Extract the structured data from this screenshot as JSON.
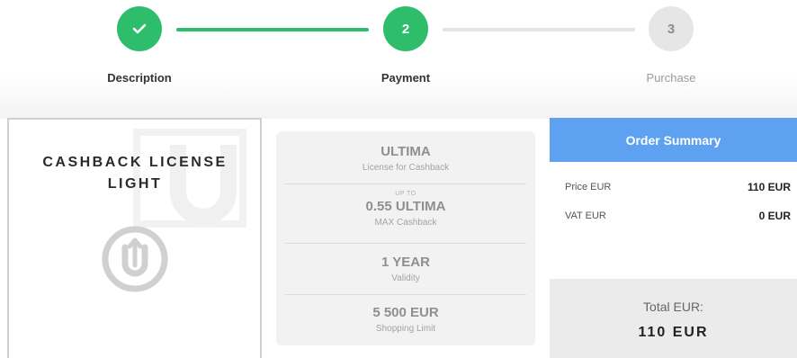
{
  "stepper": {
    "steps": [
      {
        "number": "",
        "label": "Description",
        "state": "done"
      },
      {
        "number": "2",
        "label": "Payment",
        "state": "active"
      },
      {
        "number": "3",
        "label": "Purchase",
        "state": "todo"
      }
    ]
  },
  "product": {
    "title": "CASHBACK LICENSE LIGHT"
  },
  "features": {
    "plan": {
      "value": "ULTIMA",
      "caption": "License for Cashback"
    },
    "cashback": {
      "prefix": "UP TO",
      "value": "0.55 ULTIMA",
      "caption": "MAX Cashback"
    },
    "validity": {
      "value": "1 YEAR",
      "caption": "Validity"
    },
    "limit": {
      "value": "5 500 EUR",
      "caption": "Shopping Limit"
    }
  },
  "order_summary": {
    "title": "Order Summary",
    "rows": [
      {
        "label": "Price EUR",
        "value": "110 EUR"
      },
      {
        "label": "VAT EUR",
        "value": "0 EUR"
      }
    ],
    "total_label": "Total EUR:",
    "total_value": "110 EUR"
  },
  "colors": {
    "accent_green": "#2ebd6b",
    "summary_blue": "#5da1f0"
  },
  "icons": {
    "step1": "checkmark-icon",
    "product": "ultima-logo-icon"
  }
}
